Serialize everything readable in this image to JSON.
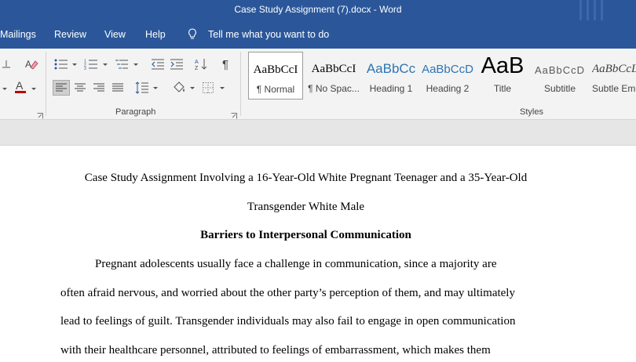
{
  "window": {
    "title": "Case Study Assignment (7).docx  -  Word"
  },
  "menu": {
    "items": [
      "Mailings",
      "Review",
      "View",
      "Help"
    ],
    "tell_me": "Tell me what you want to do"
  },
  "ribbon": {
    "paragraph_label": "Paragraph",
    "styles_label": "Styles",
    "styles": [
      {
        "preview": "AaBbCcI",
        "name": "¶ Normal"
      },
      {
        "preview": "AaBbCcI",
        "name": "¶ No Spac..."
      },
      {
        "preview": "AaBbCc",
        "name": "Heading 1"
      },
      {
        "preview": "AaBbCcD",
        "name": "Heading 2"
      },
      {
        "preview": "AaB",
        "name": "Title"
      },
      {
        "preview": "AaBbCcD",
        "name": "Subtitle"
      },
      {
        "preview": "AaBbCcL",
        "name": "Subtle Em..."
      }
    ],
    "colors": {
      "font_color": "#c00000",
      "accent": "#2b579a",
      "heading_color": "#2e74b5"
    }
  },
  "document": {
    "title_line1": "Case Study Assignment Involving a 16-Year-Old White Pregnant Teenager and a 35-Year-Old",
    "title_line2": "Transgender White Male",
    "heading": "Barriers to Interpersonal Communication",
    "para_lines": [
      "Pregnant adolescents usually face a challenge in communication, since a majority are",
      "often afraid nervous, and worried about the other party’s perception of them, and may ultimately",
      "lead to feelings of guilt. Transgender individuals may also fail to engage in open communication",
      "with their healthcare personnel, attributed to feelings of embarrassment, which makes them"
    ]
  }
}
